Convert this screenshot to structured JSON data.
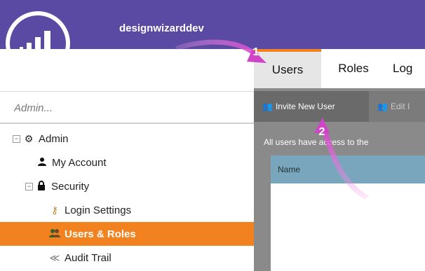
{
  "header": {
    "app_name": "designwizarddev"
  },
  "sidebar": {
    "search_placeholder": "Admin...",
    "items": [
      {
        "label": "Admin"
      },
      {
        "label": "My Account"
      },
      {
        "label": "Security"
      },
      {
        "label": "Login Settings"
      },
      {
        "label": "Users & Roles"
      },
      {
        "label": "Audit Trail"
      }
    ],
    "selected": "Users & Roles"
  },
  "tabs": [
    {
      "label": "Users"
    },
    {
      "label": "Roles"
    },
    {
      "label": "Log"
    }
  ],
  "toolbar": {
    "invite_label": "Invite New User",
    "edit_label": "Edit I"
  },
  "main": {
    "description": "All users     have access to the",
    "grid_header": "Name"
  },
  "annotations": [
    "1",
    "2"
  ],
  "colors": {
    "brand_purple": "#5b4aa3",
    "accent_orange": "#f1821f",
    "arrow_magenta": "#d044c8",
    "grid_header_blue": "#7aa6bd"
  }
}
